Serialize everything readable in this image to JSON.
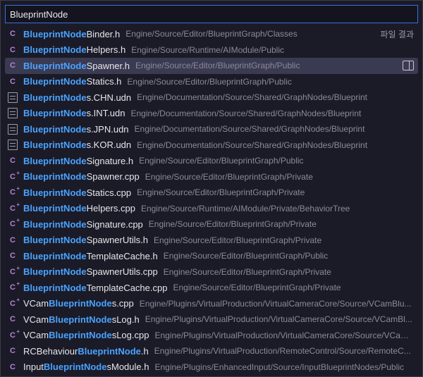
{
  "search": {
    "value": "BlueprintNode"
  },
  "badge": "파일 결과",
  "rows": [
    {
      "icon": "c",
      "pre": "",
      "hl": "BlueprintNode",
      "suf": "Binder.h",
      "path": "Engine/Source/Editor/BlueprintGraph/Classes",
      "selected": false,
      "showBadge": true
    },
    {
      "icon": "c",
      "pre": "",
      "hl": "BlueprintNode",
      "suf": "Helpers.h",
      "path": "Engine/Source/Runtime/AIModule/Public",
      "selected": false
    },
    {
      "icon": "c",
      "pre": "",
      "hl": "BlueprintNode",
      "suf": "Spawner.h",
      "path": "Engine/Source/Editor/BlueprintGraph/Public",
      "selected": true,
      "showSplit": true
    },
    {
      "icon": "c",
      "pre": "",
      "hl": "BlueprintNode",
      "suf": "Statics.h",
      "path": "Engine/Source/Editor/BlueprintGraph/Public",
      "selected": false
    },
    {
      "icon": "doc",
      "pre": "",
      "hl": "BlueprintNode",
      "suf": "s.CHN.udn",
      "path": "Engine/Documentation/Source/Shared/GraphNodes/Blueprint",
      "selected": false
    },
    {
      "icon": "doc",
      "pre": "",
      "hl": "BlueprintNode",
      "suf": "s.INT.udn",
      "path": "Engine/Documentation/Source/Shared/GraphNodes/Blueprint",
      "selected": false
    },
    {
      "icon": "doc",
      "pre": "",
      "hl": "BlueprintNode",
      "suf": "s.JPN.udn",
      "path": "Engine/Documentation/Source/Shared/GraphNodes/Blueprint",
      "selected": false
    },
    {
      "icon": "doc",
      "pre": "",
      "hl": "BlueprintNode",
      "suf": "s.KOR.udn",
      "path": "Engine/Documentation/Source/Shared/GraphNodes/Blueprint",
      "selected": false
    },
    {
      "icon": "c",
      "pre": "",
      "hl": "BlueprintNode",
      "suf": "Signature.h",
      "path": "Engine/Source/Editor/BlueprintGraph/Public",
      "selected": false
    },
    {
      "icon": "cp",
      "pre": "",
      "hl": "BlueprintNode",
      "suf": "Spawner.cpp",
      "path": "Engine/Source/Editor/BlueprintGraph/Private",
      "selected": false
    },
    {
      "icon": "cp",
      "pre": "",
      "hl": "BlueprintNode",
      "suf": "Statics.cpp",
      "path": "Engine/Source/Editor/BlueprintGraph/Private",
      "selected": false
    },
    {
      "icon": "cp",
      "pre": "",
      "hl": "BlueprintNode",
      "suf": "Helpers.cpp",
      "path": "Engine/Source/Runtime/AIModule/Private/BehaviorTree",
      "selected": false
    },
    {
      "icon": "cp",
      "pre": "",
      "hl": "BlueprintNode",
      "suf": "Signature.cpp",
      "path": "Engine/Source/Editor/BlueprintGraph/Private",
      "selected": false
    },
    {
      "icon": "c",
      "pre": "",
      "hl": "BlueprintNode",
      "suf": "SpawnerUtils.h",
      "path": "Engine/Source/Editor/BlueprintGraph/Private",
      "selected": false
    },
    {
      "icon": "c",
      "pre": "",
      "hl": "BlueprintNode",
      "suf": "TemplateCache.h",
      "path": "Engine/Source/Editor/BlueprintGraph/Public",
      "selected": false
    },
    {
      "icon": "cp",
      "pre": "",
      "hl": "BlueprintNode",
      "suf": "SpawnerUtils.cpp",
      "path": "Engine/Source/Editor/BlueprintGraph/Private",
      "selected": false
    },
    {
      "icon": "cp",
      "pre": "",
      "hl": "BlueprintNode",
      "suf": "TemplateCache.cpp",
      "path": "Engine/Source/Editor/BlueprintGraph/Private",
      "selected": false
    },
    {
      "icon": "cp",
      "pre": "VCam",
      "hl": "BlueprintNode",
      "suf": "s.cpp",
      "path": "Engine/Plugins/VirtualProduction/VirtualCameraCore/Source/VCamBlu...",
      "selected": false
    },
    {
      "icon": "c",
      "pre": "VCam",
      "hl": "BlueprintNode",
      "suf": "sLog.h",
      "path": "Engine/Plugins/VirtualProduction/VirtualCameraCore/Source/VCamBl...",
      "selected": false
    },
    {
      "icon": "cp",
      "pre": "VCam",
      "hl": "BlueprintNode",
      "suf": "sLog.cpp",
      "path": "Engine/Plugins/VirtualProduction/VirtualCameraCore/Source/VCam...",
      "selected": false
    },
    {
      "icon": "c",
      "pre": "RCBehaviour",
      "hl": "BlueprintNode",
      "suf": ".h",
      "path": "Engine/Plugins/VirtualProduction/RemoteControl/Source/RemoteC...",
      "selected": false
    },
    {
      "icon": "c",
      "pre": "Input",
      "hl": "BlueprintNode",
      "suf": "sModule.h",
      "path": "Engine/Plugins/EnhancedInput/Source/InputBlueprintNodes/Public",
      "selected": false
    }
  ]
}
